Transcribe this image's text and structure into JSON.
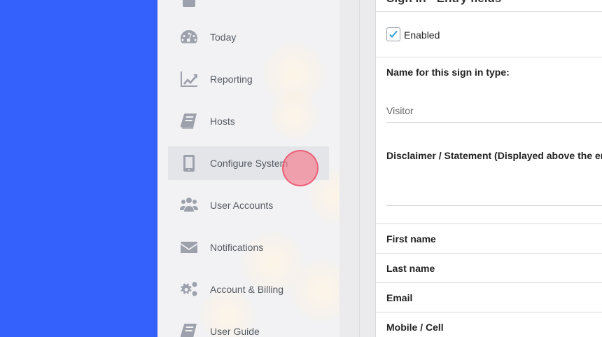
{
  "sidebar": {
    "items": [
      {
        "label": "Today",
        "icon": "dashboard-icon"
      },
      {
        "label": "Reporting",
        "icon": "chart-line-icon"
      },
      {
        "label": "Hosts",
        "icon": "book-icon"
      },
      {
        "label": "Configure System",
        "icon": "tablet-icon"
      },
      {
        "label": "User Accounts",
        "icon": "users-icon"
      },
      {
        "label": "Notifications",
        "icon": "envelope-icon"
      },
      {
        "label": "Account & Billing",
        "icon": "gears-icon"
      },
      {
        "label": "User Guide",
        "icon": "book-icon"
      }
    ],
    "selected": "Configure System"
  },
  "panel": {
    "heading": "Sign in - Entry fields",
    "enabled_label": "Enabled",
    "enabled_checked": true,
    "name_label": "Name for this sign in type:",
    "name_value": "Visitor",
    "disclaimer_label": "Disclaimer / Statement (Displayed above the entry fields)",
    "fields": [
      "First name",
      "Last name",
      "Email",
      "Mobile / Cell"
    ]
  },
  "colors": {
    "background": "#3461fb",
    "sidebar": "#f2f2f4",
    "icon": "#9da1ab",
    "check": "#2a9fd8"
  }
}
